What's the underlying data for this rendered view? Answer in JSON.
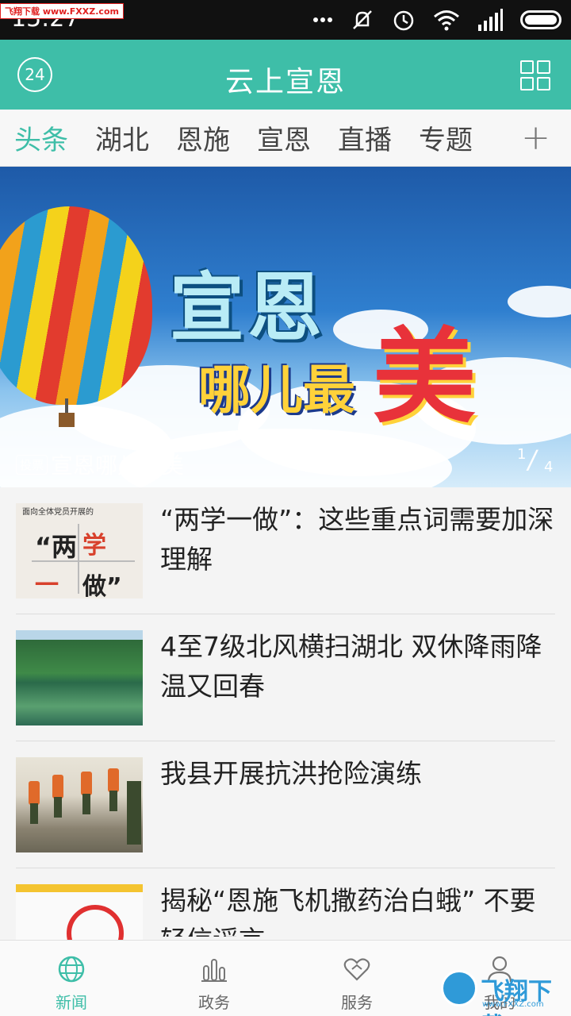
{
  "status_bar": {
    "time": "15:27",
    "watermark": "飞翔下载 www.FXXZ.com"
  },
  "app_bar": {
    "weather_badge": "24",
    "title": "云上宣恩"
  },
  "channels": {
    "items": [
      "头条",
      "湖北",
      "恩施",
      "宣恩",
      "直播",
      "专题"
    ],
    "active_index": 0,
    "add_label": "+"
  },
  "banner": {
    "title_line1": "宣恩",
    "title_line2": "哪儿最",
    "title_accent": "美",
    "tag": "投票",
    "caption": "宣恩哪儿最美",
    "page_current": "1",
    "page_total": "4"
  },
  "news": [
    {
      "title": "“两学一做”：这些重点词需要加深理解",
      "thumb_header": "面向全体党员开展的",
      "thumb_words": [
        "“两",
        "学",
        "一",
        "做”"
      ]
    },
    {
      "title": "4至7级北风横扫湖北 双休降雨降温又回春"
    },
    {
      "title": "我县开展抗洪抢险演练"
    },
    {
      "title": "揭秘“恩施飞机撒药治白蛾” 不要轻信谣言"
    }
  ],
  "bottom_nav": {
    "items": [
      {
        "label": "新闻",
        "icon": "globe-icon"
      },
      {
        "label": "政务",
        "icon": "bar-chart-icon"
      },
      {
        "label": "服务",
        "icon": "heart-icon"
      },
      {
        "label": "我的",
        "icon": "person-icon"
      }
    ],
    "active_index": 0
  },
  "watermark_logo": {
    "text": "飞翔下载",
    "url": "www.FXXZ.com"
  },
  "colors": {
    "accent": "#3ebea8",
    "status_bar": "#111111",
    "text_primary": "#222222"
  }
}
